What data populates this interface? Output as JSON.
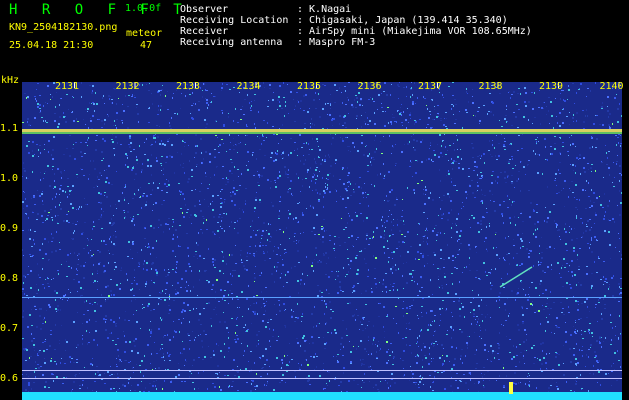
{
  "header": {
    "brand": "H R O F F T",
    "version": "1.0.0f",
    "filename": "KN9_2504182130.png",
    "meteor_label": "meteor",
    "datetime": "25.04.18 21:30",
    "meteor_count": "47",
    "info": [
      {
        "label": "Observer",
        "value": ": K.Nagai"
      },
      {
        "label": "Receiving Location",
        "value": ": Chigasaki, Japan (139.414 35.340)"
      },
      {
        "label": "Receiver",
        "value": ": AirSpy mini (Miakejima VOR 108.65MHz)"
      },
      {
        "label": "Receiving antenna",
        "value": ": Maspro FM-3"
      }
    ]
  },
  "plot": {
    "y_unit": "kHz",
    "y_ticks": [
      "1.1",
      "1.0",
      "0.9",
      "0.8",
      "0.7",
      "0.6"
    ],
    "x_ticks": [
      "2131",
      "2132",
      "2133",
      "2134",
      "2135",
      "2136",
      "2137",
      "2138",
      "2139",
      "2140"
    ],
    "colors": {
      "background": "#1a2a8a",
      "carrier": "#ffe060",
      "noise": "#2e4ce0"
    }
  }
}
